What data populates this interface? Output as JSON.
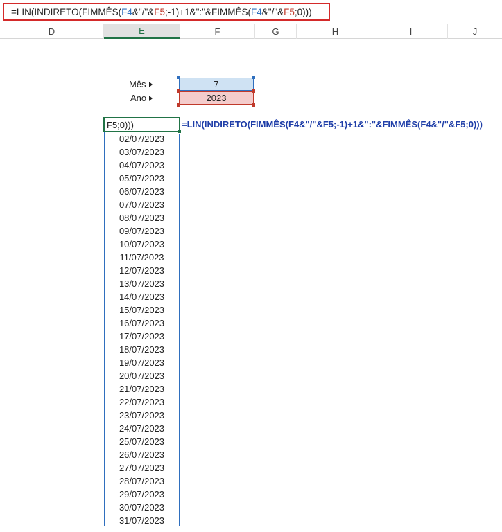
{
  "formula_bar": {
    "part1": "=LIN(INDIRETO(FIMMÊS(",
    "ref1": "F4",
    "part2": "&\"/\"&",
    "ref2": "F5",
    "part3": ";-1)+1&\":\"&FIMMÊS(",
    "ref3": "F4",
    "part4": "&\"/\"&",
    "ref4": "F5",
    "part5": ";0)))"
  },
  "columns": [
    {
      "label": "D",
      "active": false
    },
    {
      "label": "E",
      "active": true
    },
    {
      "label": "F",
      "active": false
    },
    {
      "label": "G",
      "active": false
    },
    {
      "label": "H",
      "active": false
    },
    {
      "label": "I",
      "active": false
    },
    {
      "label": "J",
      "active": false
    }
  ],
  "inputs": {
    "month_label": "Mês",
    "month_value": "7",
    "year_label": "Ano",
    "year_value": "2023"
  },
  "cell_edit_text": "F5;0)))",
  "formula_display": "=LIN(INDIRETO(FIMMÊS(F4&\"/\"&F5;-1)+1&\":\"&FIMMÊS(F4&\"/\"&F5;0)))",
  "dates": [
    "02/07/2023",
    "03/07/2023",
    "04/07/2023",
    "05/07/2023",
    "06/07/2023",
    "07/07/2023",
    "08/07/2023",
    "09/07/2023",
    "10/07/2023",
    "11/07/2023",
    "12/07/2023",
    "13/07/2023",
    "14/07/2023",
    "15/07/2023",
    "16/07/2023",
    "17/07/2023",
    "18/07/2023",
    "19/07/2023",
    "20/07/2023",
    "21/07/2023",
    "22/07/2023",
    "23/07/2023",
    "24/07/2023",
    "25/07/2023",
    "26/07/2023",
    "27/07/2023",
    "28/07/2023",
    "29/07/2023",
    "30/07/2023",
    "31/07/2023"
  ],
  "colors": {
    "month_fill": "#cfe2f3",
    "year_fill": "#f4cccc",
    "formula_border": "#d42a2a",
    "selection": "#217346",
    "formula_text": "#1f3ea8"
  }
}
